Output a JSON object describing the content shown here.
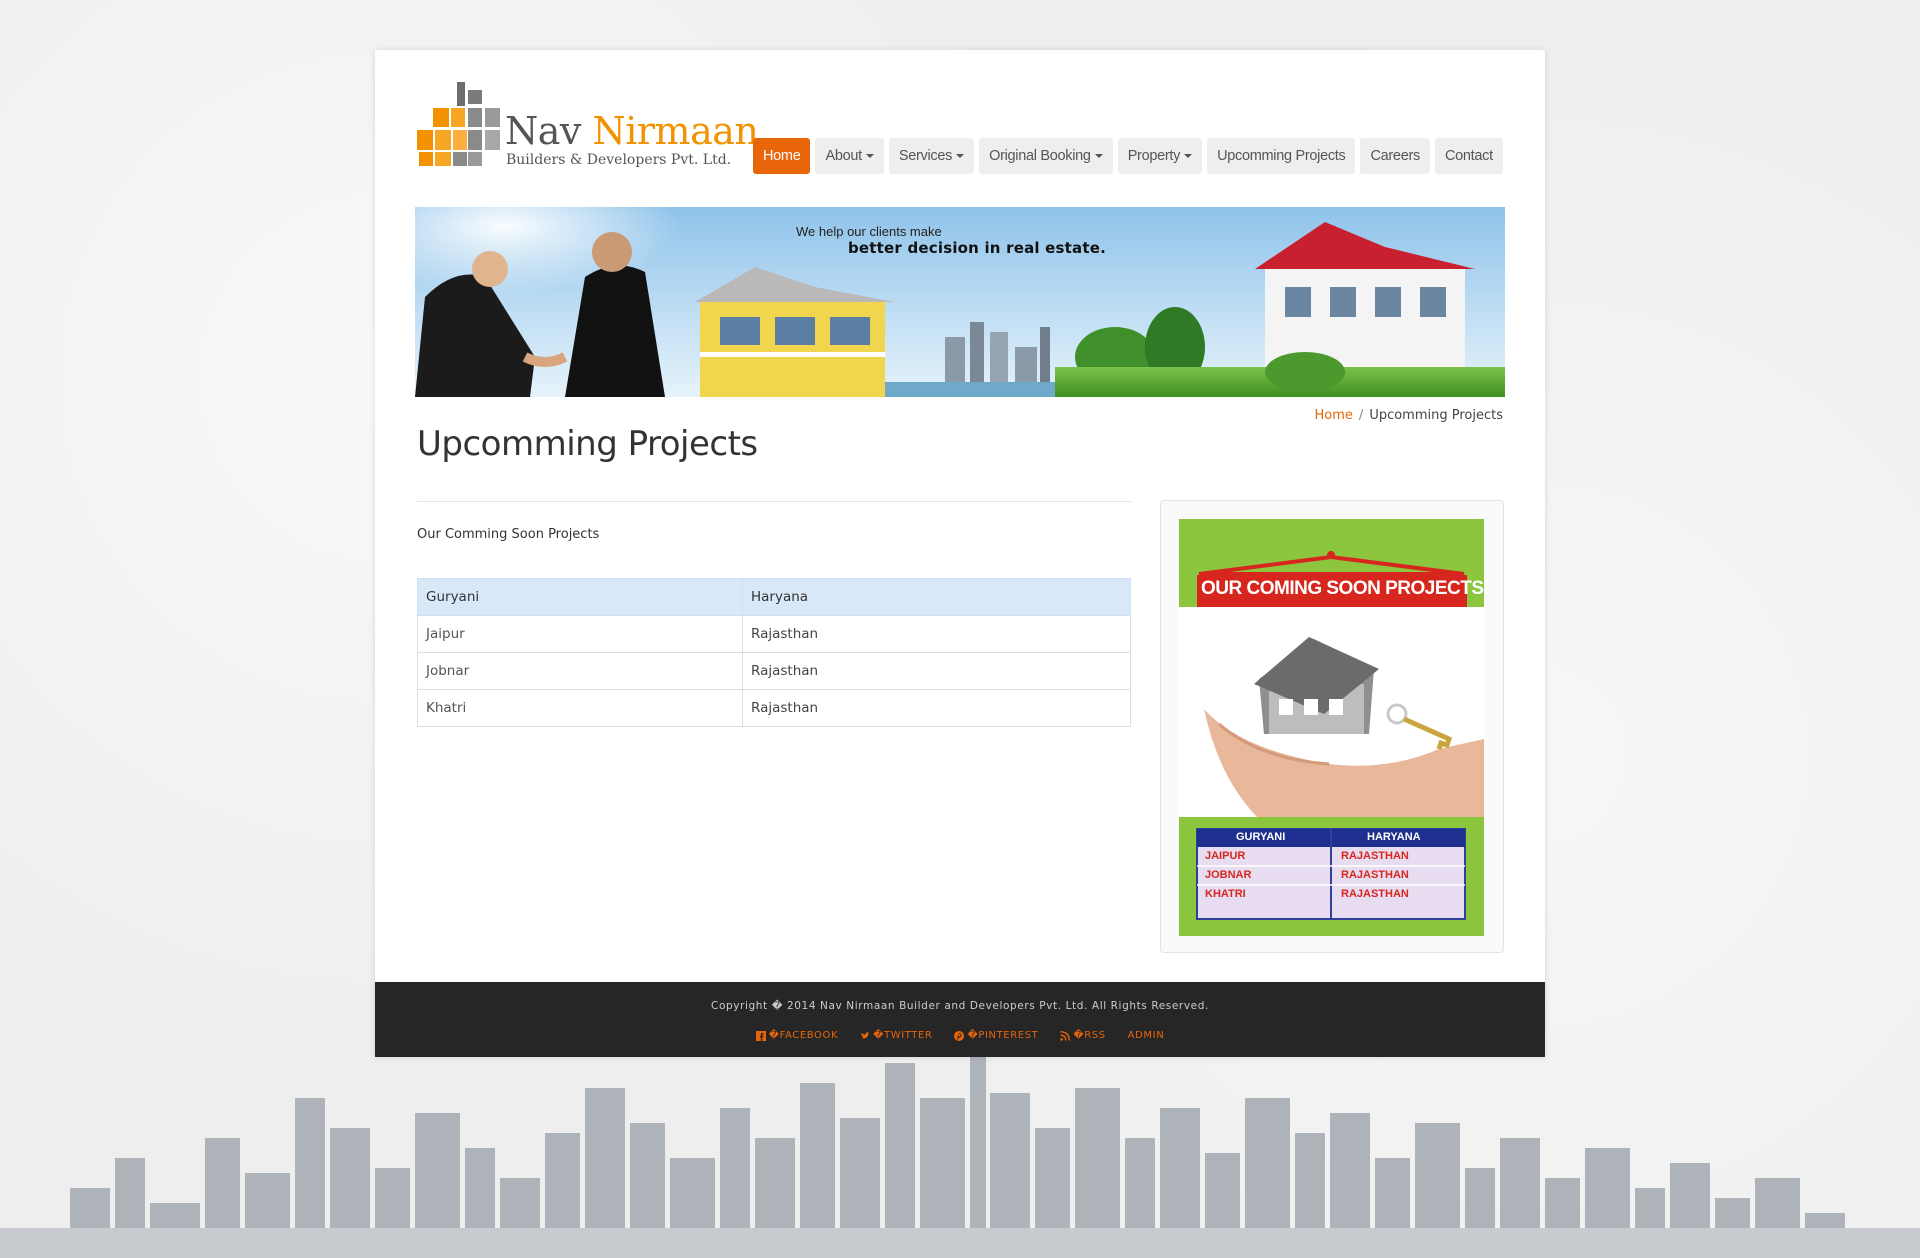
{
  "brand": {
    "name_part1": "Nav",
    "name_part2": "Nirmaan",
    "tagline": "Builders & Developers Pvt. Ltd.",
    "accent_color": "#f39200"
  },
  "nav": {
    "items": [
      {
        "label": "Home",
        "active": true,
        "dropdown": false
      },
      {
        "label": "About",
        "active": false,
        "dropdown": true
      },
      {
        "label": "Services",
        "active": false,
        "dropdown": true
      },
      {
        "label": "Original Booking",
        "active": false,
        "dropdown": true
      },
      {
        "label": "Property",
        "active": false,
        "dropdown": true
      },
      {
        "label": "Upcomming Projects",
        "active": false,
        "dropdown": false
      },
      {
        "label": "Careers",
        "active": false,
        "dropdown": false
      },
      {
        "label": "Contact",
        "active": false,
        "dropdown": false
      }
    ],
    "active_color": "#e8650a"
  },
  "banner": {
    "line1": "We help our clients make",
    "line2": "better decision in real estate."
  },
  "breadcrumb": {
    "home": "Home",
    "current": "Upcomming Projects"
  },
  "page": {
    "title": "Upcomming Projects",
    "intro": "Our Comming Soon Projects"
  },
  "projects_table": {
    "headers": [
      "Guryani",
      "Haryana"
    ],
    "rows": [
      [
        "Jaipur",
        "Rajasthan"
      ],
      [
        "Jobnar",
        "Rajasthan"
      ],
      [
        "Khatri",
        "Rajasthan"
      ]
    ]
  },
  "side_image": {
    "heading": "OUR COMING SOON PROJECTS",
    "table_headers": [
      "GURYANI",
      "HARYANA"
    ],
    "table_rows": [
      [
        "JAIPUR",
        "RAJASTHAN"
      ],
      [
        "JOBNAR",
        "RAJASTHAN"
      ],
      [
        "KHATRI",
        "RAJASTHAN"
      ]
    ]
  },
  "footer": {
    "copyright": "Copyright � 2014 Nav Nirmaan Builder and Developers Pvt. Ltd. All Rights Reserved.",
    "links": [
      {
        "label": "�FACEBOOK",
        "icon": "facebook-icon"
      },
      {
        "label": "�TWITTER",
        "icon": "twitter-icon"
      },
      {
        "label": "�PINTEREST",
        "icon": "pinterest-icon"
      },
      {
        "label": "�RSS",
        "icon": "rss-icon"
      },
      {
        "label": "ADMIN",
        "icon": ""
      }
    ],
    "link_color": "#e8650a"
  }
}
